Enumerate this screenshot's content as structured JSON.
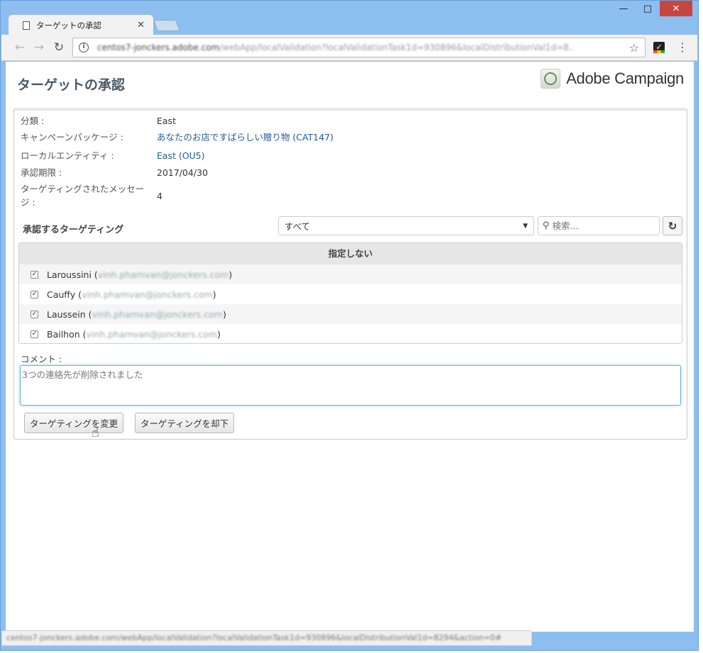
{
  "browser": {
    "tab_title": "ターゲットの承認",
    "url_host": "centos7-jonckers.adobe.com",
    "url_path": "/webApp/localValidation?localValidationTask1d=930896&localDistributionVal1d=8..",
    "status_url": "centos7-jonckers.adobe.com/webApp/localValidation?localValidationTask1d=930896&localDistributionVal1d=8294&action=0#"
  },
  "header": {
    "title": "ターゲットの承認",
    "logo_text": "Adobe Campaign"
  },
  "fields": [
    {
      "label": "分類 :",
      "value": "East",
      "link": false
    },
    {
      "label": "キャンペーンパッケージ :",
      "value": "あなたのお店ですばらしい贈り物 (CAT147)",
      "link": true
    },
    {
      "label": "ローカルエンティティ :",
      "value": "East (OU5)",
      "link": true
    },
    {
      "label": "承認期限 :",
      "value": "2017/04/30",
      "link": false
    },
    {
      "label": "ターゲティングされたメッセージ :",
      "value": "4",
      "link": false
    }
  ],
  "targeting": {
    "section_label": "承認するターゲティング",
    "filter_value": "すべて",
    "search_placeholder": "検索...",
    "group_header": "指定しない",
    "rows": [
      {
        "name": "Laroussini",
        "email": "vinh.phamvan@jonckers.com",
        "checked": true
      },
      {
        "name": "Cauffy",
        "email": "vinh.phamvan@jonckers.com",
        "checked": true
      },
      {
        "name": "Laussein",
        "email": "vinh.phamvan@jonckers.com",
        "checked": true
      },
      {
        "name": "Bailhon",
        "email": "vinh.phamvan@jonckers.com",
        "checked": true
      }
    ]
  },
  "comment": {
    "label": "コメント :",
    "value": "3つの連絡先が削除されました"
  },
  "actions": {
    "change_label": "ターゲティングを変更",
    "reject_label": "ターゲティングを却下"
  }
}
